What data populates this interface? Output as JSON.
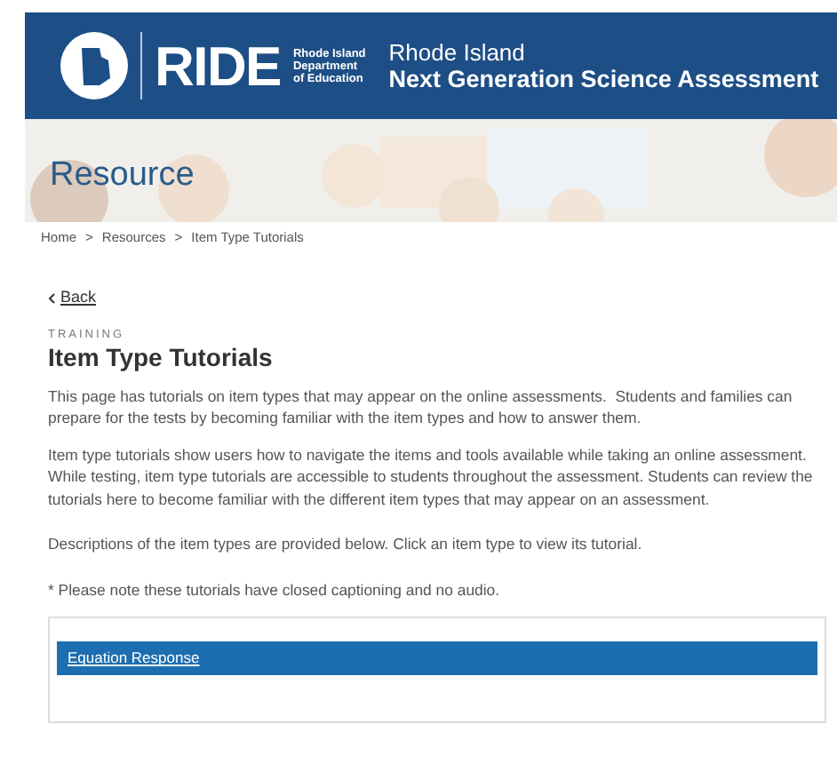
{
  "header": {
    "logo_text": "RIDE",
    "department_lines": [
      "Rhode Island",
      "Department",
      "of Education"
    ],
    "site_title": "Rhode Island",
    "site_subtitle": "Next Generation Science Assessment"
  },
  "banner": {
    "kind": "picture",
    "title": "Resource"
  },
  "breadcrumbs": [
    {
      "label": "Home"
    },
    {
      "label": "Resources"
    },
    {
      "label": "Item Type Tutorials"
    }
  ],
  "breadcrumb_separator": ">",
  "back_link": "Back",
  "eyebrow": "TRAINING",
  "title": "Item Type Tutorials",
  "paragraphs": [
    "This page has tutorials on item types that may appear on the online assessments.  Students and families can prepare for the tests by becoming familiar with the item types and how to answer them.",
    "Item type tutorials show users how to navigate the items and tools available while taking an online assessment. While testing, item type tutorials are accessible to students throughout the assessment. Students can review the tutorials here to become familiar with the different item types that may appear on an assessment.",
    "Descriptions of the item types are provided below. Click an item type to view its tutorial.",
    "* Please note these tutorials have closed captioning and no audio."
  ],
  "tutorials": [
    {
      "label": "Equation Response"
    }
  ]
}
